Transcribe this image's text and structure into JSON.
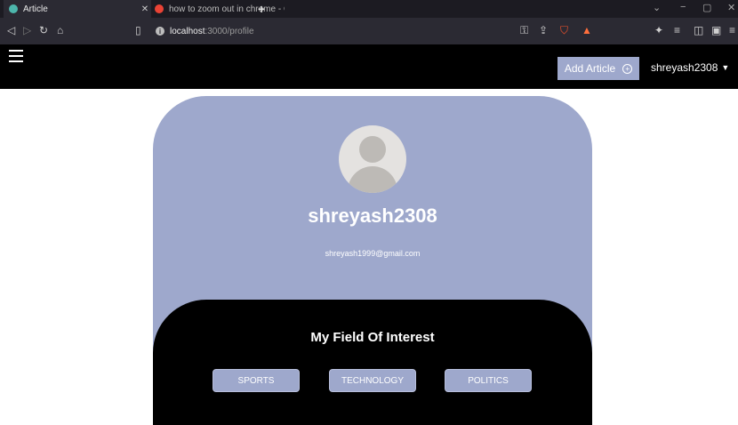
{
  "browser": {
    "tabs": [
      {
        "title": "Article",
        "active": true,
        "favicon_color": "#4db6ac"
      },
      {
        "title": "how to zoom out in chrome - Google",
        "active": false,
        "favicon_color": "#ea4335"
      }
    ],
    "url": {
      "host": "localhost",
      "path": ":3000/profile"
    }
  },
  "navbar": {
    "add_article_label": "Add Article",
    "user_label": "shreyash2308"
  },
  "profile": {
    "username": "shreyash2308",
    "email": "shreyash1999@gmail.com"
  },
  "interests": {
    "title": "My Field Of Interest",
    "items": [
      "SPORTS",
      "TECHNOLOGY",
      "POLITICS"
    ]
  },
  "colors": {
    "accent": "#9ea8cc",
    "navbar": "#000000"
  }
}
